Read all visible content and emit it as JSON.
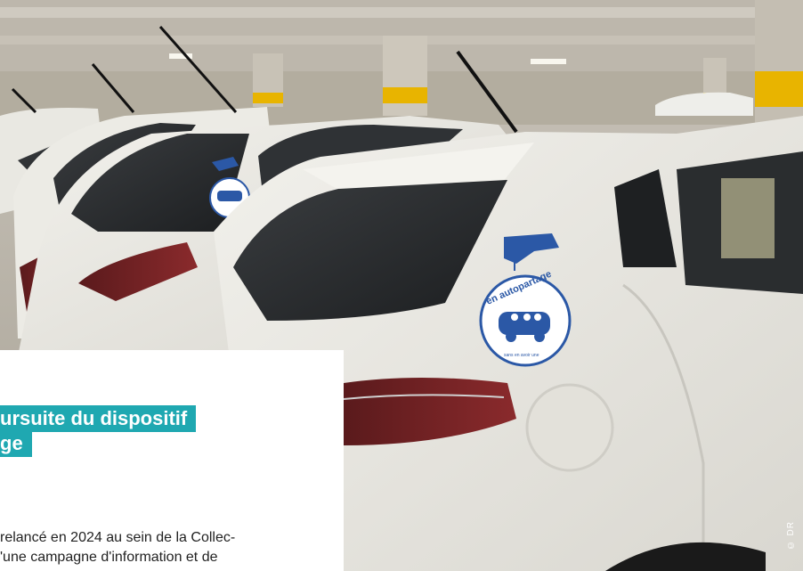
{
  "article": {
    "headline_line1": "ursuite du dispositif",
    "headline_line2": "ge",
    "body_line1": "relancé en 2024 au sein de la Collec-",
    "body_line2": "'une campagne d'information et de"
  },
  "photo": {
    "sticker_text": "en autopartage",
    "sticker_subtext": "sans en avoir une",
    "credit": "© DR"
  },
  "colors": {
    "accent": "#1fa8b1",
    "sticker_blue": "#2b58a6"
  }
}
